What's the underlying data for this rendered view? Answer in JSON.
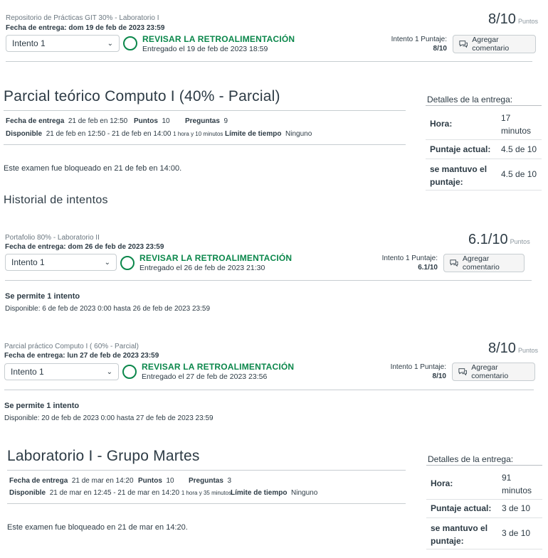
{
  "common": {
    "review_label": "REVISAR LA RETROALIMENTACIÓN",
    "comment_button": "Agregar comentario",
    "points_unit": "Puntos",
    "details_title": "Detalles de la entrega:",
    "label_time": "Hora:",
    "label_current": "Puntaje actual:",
    "label_kept": "se mantuvo el puntaje:",
    "label_due": "Fecha de entrega",
    "label_points": "Puntos",
    "label_questions": "Preguntas",
    "label_available": "Disponible",
    "label_time_limit": "Límite de tiempo",
    "time_limit_value": "Ninguno",
    "allowed_attempts": "Se permite 1 intento"
  },
  "assignment1": {
    "name": "Repositorio de Prácticas GIT 30% - Laboratorio I",
    "due": "Fecha de entrega: dom 19 de feb de 2023 23:59",
    "attempt": "Intento 1",
    "submitted": "Entregado el 19 de feb de 2023 18:59",
    "attempt_score_label": "Intento 1 Puntaje:",
    "attempt_score": "8/10",
    "score": "8/10"
  },
  "quiz1": {
    "title": "Parcial teórico Computo I (40% - Parcial)",
    "due_value": "21 de feb en 12:50",
    "points_value": "10",
    "questions_value": "9",
    "available_value": "21 de feb en 12:50 - 21 de feb en 14:00",
    "available_duration": "1 hora y 10 minutos",
    "locked_msg": "Este examen fue bloqueado en 21 de feb en 14:00.",
    "time_value": "17 minutos",
    "current_value": "4.5 de 10",
    "kept_value": "4.5 de 10"
  },
  "history_title": "Historial de intentos",
  "assignment2": {
    "name": "Portafolio 80% - Laboratorio II",
    "due": "Fecha de entrega: dom 26 de feb de 2023 23:59",
    "attempt": "Intento 1",
    "submitted": "Entregado el 26 de feb de 2023 21:30",
    "attempt_score_label": "Intento 1 Puntaje:",
    "attempt_score": "6.1/10",
    "score": "6.1/10",
    "availability": "Disponible: 6 de feb de 2023 0:00 hasta 26 de feb de 2023 23:59"
  },
  "assignment3": {
    "name": "Parcial práctico Computo I ( 60% - Parcial)",
    "due": "Fecha de entrega: lun 27 de feb de 2023 23:59",
    "attempt": "Intento 1",
    "submitted": "Entregado el 27 de feb de 2023 23:56",
    "attempt_score_label": "Intento 1 Puntaje:",
    "attempt_score": "8/10",
    "score": "8/10",
    "availability": "Disponible: 20 de feb de 2023 0:00 hasta 27 de feb de 2023 23:59"
  },
  "quiz2": {
    "title": "Laboratorio I - Grupo Martes",
    "due_value": "21 de mar en 14:20",
    "points_value": "10",
    "questions_value": "3",
    "available_value": "21 de mar en 12:45 - 21 de mar en 14:20",
    "available_duration": "1 hora y 35 minutos",
    "locked_msg": "Este examen fue bloqueado en 21 de mar en 14:20.",
    "time_value": "91 minutos",
    "current_value": "3 de 10",
    "kept_value": "3 de 10"
  }
}
